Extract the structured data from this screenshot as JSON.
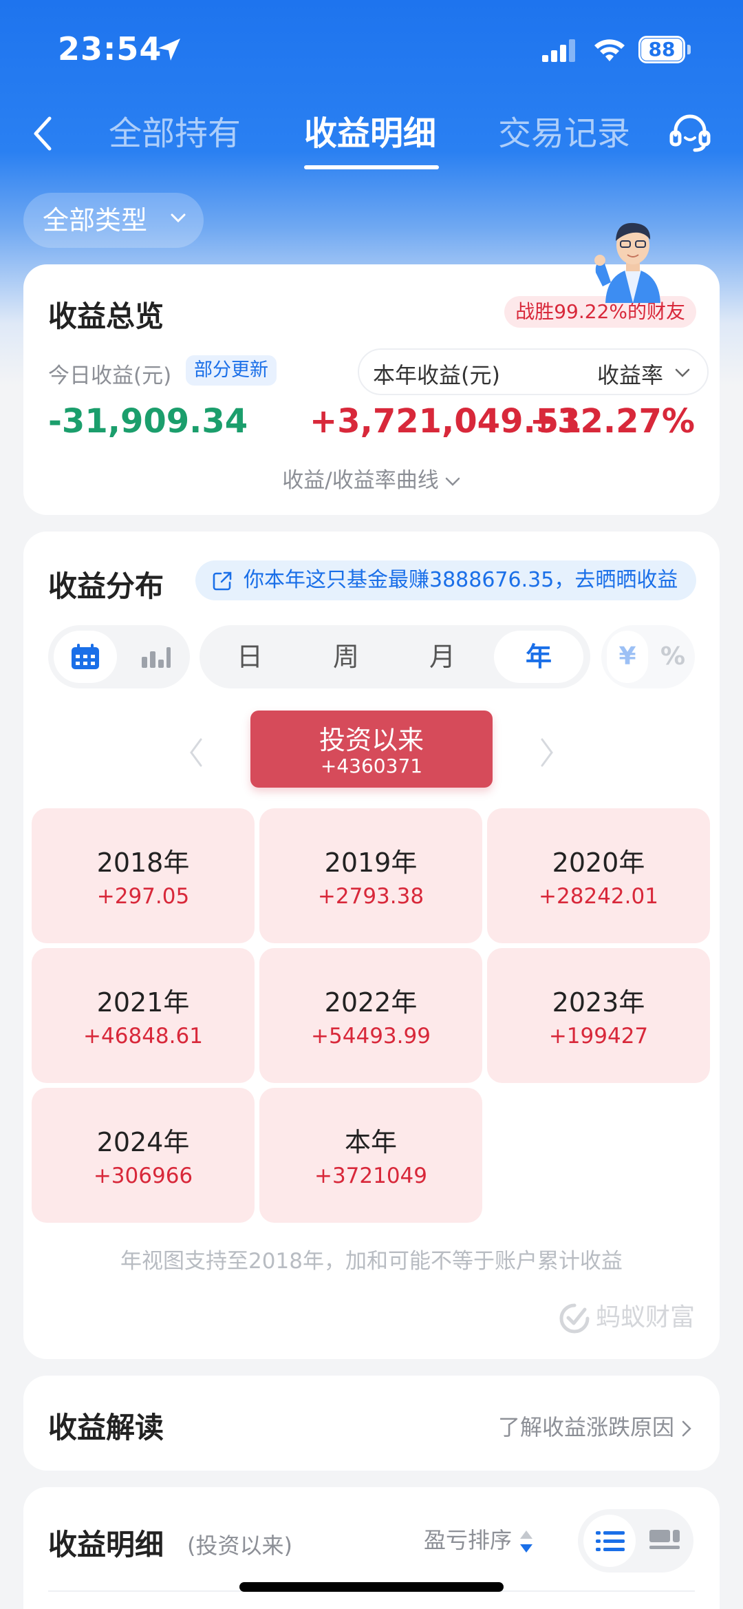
{
  "status_bar": {
    "time": "23:54",
    "battery": "88"
  },
  "nav": {
    "tabs": [
      {
        "label": "全部持有"
      },
      {
        "label": "收益明细"
      },
      {
        "label": "交易记录"
      }
    ],
    "active_tab": 1
  },
  "filter": {
    "label": "全部类型"
  },
  "overview": {
    "title": "收益总览",
    "beat_badge": "战胜99.22%的财友",
    "today_label": "今日收益(元)",
    "partial_update": "部分更新",
    "year_label": "本年收益(元)",
    "rate_label": "收益率",
    "today_value": "-31,909.34",
    "year_value": "+3,721,049.51",
    "rate_value": "+32.27%",
    "curve_link": "收益/收益率曲线"
  },
  "distribution": {
    "title": "收益分布",
    "share_banner": "你本年这只基金最赚3888676.35，去晒晒收益",
    "period_tabs": [
      "日",
      "周",
      "月",
      "年"
    ],
    "active_period": 3,
    "unit_yen": "¥",
    "unit_pct": "%",
    "since": {
      "label": "投资以来",
      "value": "+4360371"
    },
    "years": [
      {
        "name": "2018年",
        "value": "+297.05"
      },
      {
        "name": "2019年",
        "value": "+2793.38"
      },
      {
        "name": "2020年",
        "value": "+28242.01"
      },
      {
        "name": "2021年",
        "value": "+46848.61"
      },
      {
        "name": "2022年",
        "value": "+54493.99"
      },
      {
        "name": "2023年",
        "value": "+199427"
      },
      {
        "name": "2024年",
        "value": "+306966"
      },
      {
        "name": "本年",
        "value": "+3721049"
      }
    ],
    "note": "年视图支持至2018年，加和可能不等于账户累计收益",
    "brand": "蚂蚁财富"
  },
  "interpretation": {
    "title": "收益解读",
    "link": "了解收益涨跌原因"
  },
  "detail": {
    "title": "收益明细",
    "subtitle": "(投资以来)",
    "sort_label": "盈亏排序"
  },
  "colors": {
    "primary_blue": "#1e74ee",
    "gain_red": "#d8283a",
    "loss_green": "#1b9e6c",
    "since_box": "#d64b5a",
    "year_cell_bg": "#fde9ea"
  },
  "icons": [
    "location-arrow-icon",
    "signal-icon",
    "wifi-icon",
    "back-icon",
    "customer-service-icon",
    "chevron-down-icon",
    "external-link-icon",
    "calendar-icon",
    "bar-chart-icon",
    "chevron-left-icon",
    "chevron-right-icon",
    "sort-icon",
    "list-view-icon",
    "card-view-icon",
    "ant-fortune-logo-icon"
  ]
}
